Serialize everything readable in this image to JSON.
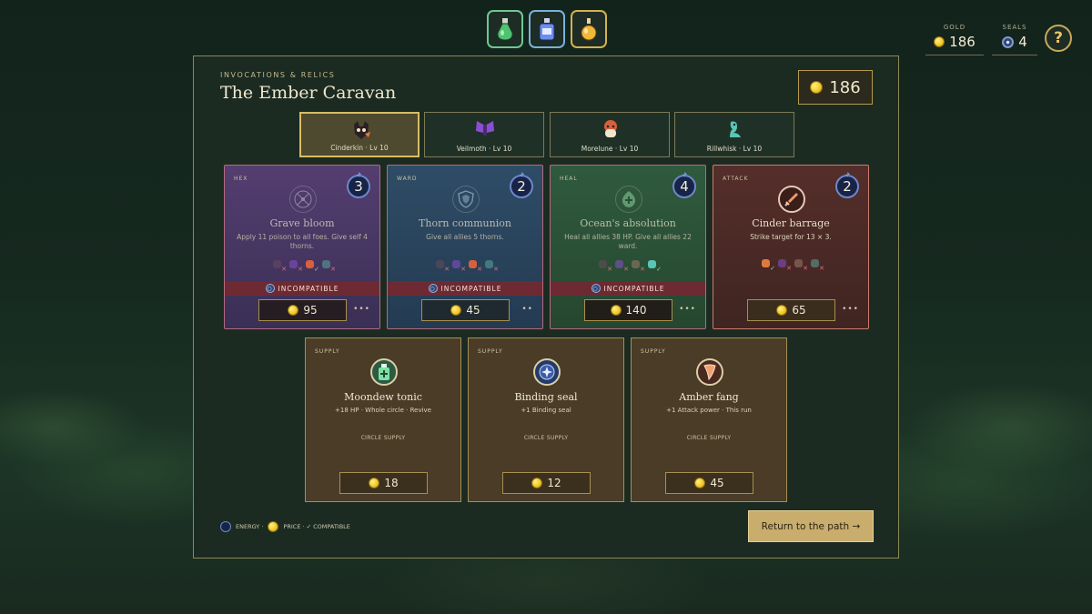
{
  "potions": [
    {
      "name": "green-potion",
      "color": "#4fc36f"
    },
    {
      "name": "blue-potion",
      "color": "#6c8ef0"
    },
    {
      "name": "gold-potion",
      "color": "#f0b83a"
    }
  ],
  "hud": {
    "gold_label": "GOLD",
    "gold_value": "186",
    "seals_label": "SEALS",
    "seals_value": "4",
    "help_label": "?"
  },
  "shop": {
    "subtitle": "INVOCATIONS & RELICS",
    "title": "The Ember Caravan",
    "gold": "186"
  },
  "party": [
    {
      "name": "Cinderkin · Lv 10",
      "color": "#e07a3c",
      "active": true
    },
    {
      "name": "Veilmoth · Lv 10",
      "color": "#8a4fd0",
      "active": false
    },
    {
      "name": "Morelune · Lv 10",
      "color": "#d9603b",
      "active": false
    },
    {
      "name": "Rillwhisk · Lv 10",
      "color": "#59c5b5",
      "active": false
    }
  ],
  "cards": [
    {
      "type": "HEX",
      "energy": "3",
      "name": "Grave bloom",
      "desc": "Apply 11 poison to all foes. Give self 4 thorns.",
      "compat": [
        "x",
        "x",
        "v",
        "x"
      ],
      "status": "INCOMPATIBLE",
      "price": "95",
      "more": "•••",
      "icon": "compass-rune-icon"
    },
    {
      "type": "WARD",
      "energy": "2",
      "name": "Thorn communion",
      "desc": "Give all allies 5 thorns.",
      "compat": [
        "x",
        "x",
        "x",
        "x"
      ],
      "status": "INCOMPATIBLE",
      "price": "45",
      "more": "••",
      "icon": "shield-icon"
    },
    {
      "type": "HEAL",
      "energy": "4",
      "name": "Ocean's absolution",
      "desc": "Heal all allies 38 HP. Give all allies 22 ward.",
      "compat": [
        "x",
        "x",
        "x",
        "v"
      ],
      "status": "INCOMPATIBLE",
      "price": "140",
      "more": "•••",
      "icon": "leaf-plus-icon"
    },
    {
      "type": "ATTACK",
      "energy": "2",
      "name": "Cinder barrage",
      "desc": "Strike target for 13 × 3.",
      "compat": [
        "v",
        "x",
        "x",
        "x"
      ],
      "status": "",
      "price": "65",
      "more": "•••",
      "icon": "sword-icon"
    }
  ],
  "supplies": [
    {
      "type": "SUPPLY",
      "name": "Moondew tonic",
      "desc": "+18 HP · Whole circle · Revive",
      "tag": "CIRCLE SUPPLY",
      "price": "18",
      "icon": "tonic-bottle-icon"
    },
    {
      "type": "SUPPLY",
      "name": "Binding seal",
      "desc": "+1 Binding seal",
      "tag": "CIRCLE SUPPLY",
      "price": "12",
      "icon": "binding-seal-icon"
    },
    {
      "type": "SUPPLY",
      "name": "Amber fang",
      "desc": "+1 Attack power · This run",
      "tag": "CIRCLE SUPPLY",
      "price": "45",
      "icon": "amber-fang-icon"
    }
  ],
  "legend": {
    "energy": "ENERGY ·",
    "price": "PRICE · ✓ COMPATIBLE"
  },
  "return_button": "Return to the path →",
  "colors": {
    "accent_gold": "#d9bd63",
    "incompatible_red": "#6d2a33",
    "energy_blue": "#6f87c9"
  }
}
